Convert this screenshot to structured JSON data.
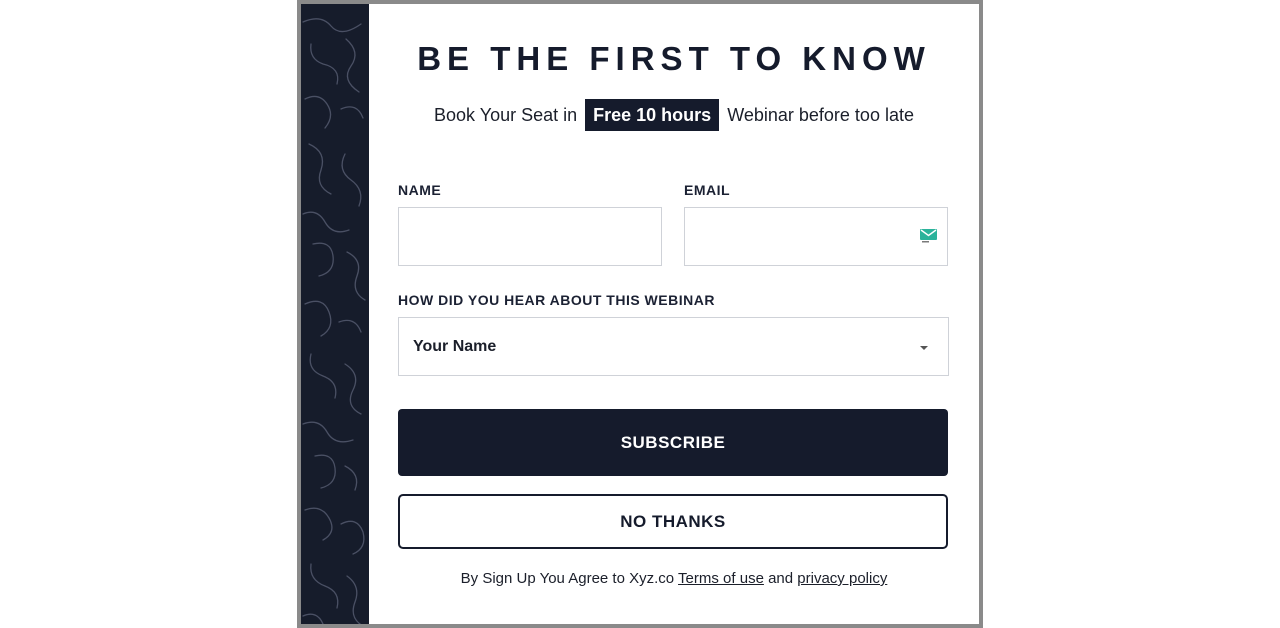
{
  "modal": {
    "title": "BE THE FIRST TO KNOW",
    "subtitle_before": "Book Your Seat in",
    "subtitle_highlight": "Free 10 hours",
    "subtitle_after": "Webinar before too late"
  },
  "form": {
    "name_label": "NAME",
    "name_value": "",
    "email_label": "EMAIL",
    "email_value": "",
    "email_icon": "envelope-icon",
    "source_label": "HOW DID YOU HEAR ABOUT THIS WEBINAR",
    "source_selected": "Your Name"
  },
  "buttons": {
    "subscribe": "SUBSCRIBE",
    "no_thanks": "NO THANKS"
  },
  "footer": {
    "text": "By Sign Up You Agree to Xyz.co",
    "terms": "Terms of use",
    "and": "and",
    "privacy": "privacy policy"
  },
  "colors": {
    "navy": "#151b2c",
    "border_gray": "#8a8a8a",
    "input_border": "#cfd2d8",
    "icon_teal": "#2bb39b"
  }
}
